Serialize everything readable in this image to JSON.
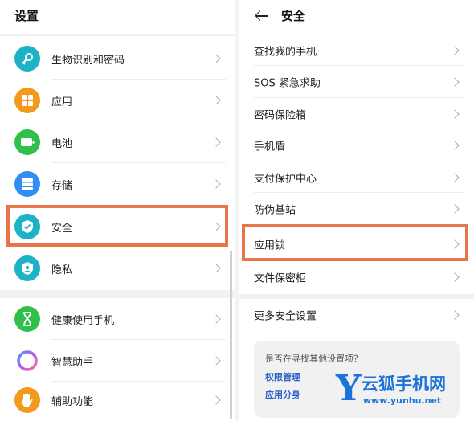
{
  "left": {
    "title": "设置",
    "items": [
      {
        "label": "生物识别和密码",
        "icon": "key-icon",
        "color": "#1eb2c6"
      },
      {
        "label": "应用",
        "icon": "apps-grid-icon",
        "color": "#f39a1e"
      },
      {
        "label": "电池",
        "icon": "battery-icon",
        "color": "#2fbf4a"
      },
      {
        "label": "存储",
        "icon": "storage-icon",
        "color": "#2f8ef0"
      },
      {
        "label": "安全",
        "icon": "shield-check-icon",
        "color": "#1eb2c6"
      },
      {
        "label": "隐私",
        "icon": "privacy-icon",
        "color": "#1eb2c6"
      },
      {
        "label": "健康使用手机",
        "icon": "hourglass-icon",
        "color": "#2fbf4a"
      },
      {
        "label": "智慧助手",
        "icon": "assistant-ring-icon",
        "color": "#8a6cf0"
      },
      {
        "label": "辅助功能",
        "icon": "hand-icon",
        "color": "#f39a1e"
      }
    ]
  },
  "right": {
    "title": "安全",
    "items": [
      {
        "label": "查找我的手机"
      },
      {
        "label": "SOS 紧急求助"
      },
      {
        "label": "密码保险箱"
      },
      {
        "label": "手机盾"
      },
      {
        "label": "支付保护中心"
      },
      {
        "label": "防伪基站"
      },
      {
        "label": "应用锁"
      },
      {
        "label": "文件保密柜"
      },
      {
        "label": "更多安全设置"
      }
    ],
    "card": {
      "question": "是否在寻找其他设置项？",
      "link1": "权限管理",
      "link2": "应用分身"
    }
  },
  "watermark": {
    "letter": "Y",
    "name": "云狐手机网",
    "url": "www.yunhu.net"
  },
  "colors": {
    "highlight": "#e8744a",
    "link": "#2a63c8",
    "brand": "#1b72d8"
  }
}
